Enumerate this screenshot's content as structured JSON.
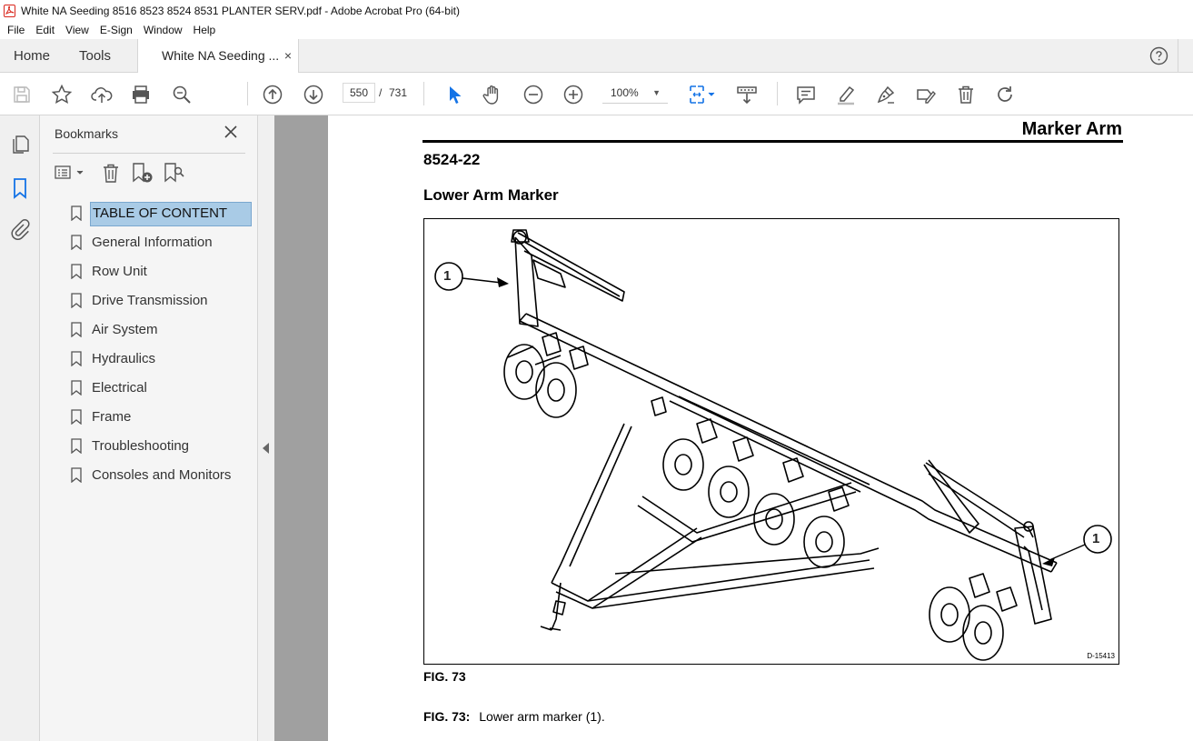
{
  "window": {
    "title": "White NA Seeding 8516  8523  8524  8531 PLANTER SERV.pdf - Adobe Acrobat Pro (64-bit)"
  },
  "menu": {
    "items": [
      "File",
      "Edit",
      "View",
      "E-Sign",
      "Window",
      "Help"
    ]
  },
  "tabs": {
    "home": "Home",
    "tools": "Tools",
    "document": "White NA Seeding ...",
    "close": "×"
  },
  "toolbar": {
    "page_current": "550",
    "page_separator": "/",
    "page_total": "731",
    "zoom": "100%",
    "icons": [
      "save-icon",
      "star-icon",
      "upload-icon",
      "print-icon",
      "search-zoom-icon",
      "page-up-icon",
      "page-down-icon",
      "select-cursor-icon",
      "hand-icon",
      "zoom-out-icon",
      "zoom-in-icon",
      "fit-page-icon",
      "scroll-mode-icon",
      "comment-icon",
      "highlight-icon",
      "sign-icon",
      "fill-sign-icon",
      "delete-icon",
      "rotate-icon"
    ]
  },
  "bookmarks": {
    "title": "Bookmarks",
    "items": [
      {
        "label": "TABLE OF CONTENT"
      },
      {
        "label": "General Information"
      },
      {
        "label": "Row Unit"
      },
      {
        "label": "Drive Transmission"
      },
      {
        "label": "Air System"
      },
      {
        "label": "Hydraulics"
      },
      {
        "label": "Electrical"
      },
      {
        "label": "Frame"
      },
      {
        "label": "Troubleshooting"
      },
      {
        "label": "Consoles and Monitors"
      }
    ]
  },
  "document": {
    "header_title": "Marker Arm",
    "section_code": "8524-22",
    "section_title": "Lower Arm Marker",
    "figure_callout": "1",
    "figure_id": "D-15413",
    "figure_label": "FIG. 73",
    "caption_prefix": "FIG. 73:",
    "caption_text": "Lower arm marker (1)."
  },
  "colors": {
    "accent_blue": "#1473e6",
    "selection": "#a9cbe6",
    "pdf_red": "#d9261c"
  }
}
